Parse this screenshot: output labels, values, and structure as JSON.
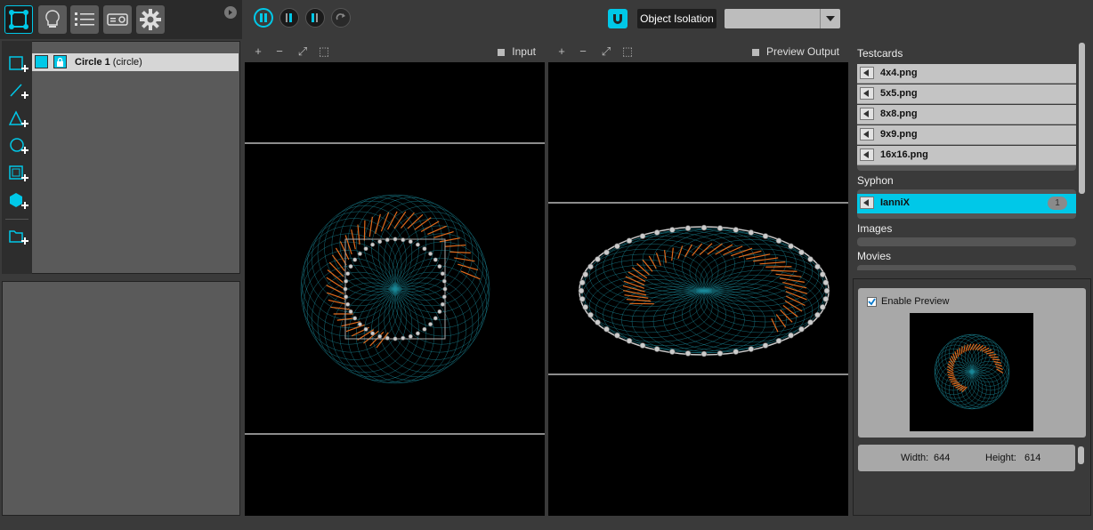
{
  "toolbar": {
    "modes": [
      {
        "name": "mapping-mode",
        "icon": "mapping-icon",
        "active": true
      },
      {
        "name": "output-mode",
        "icon": "lightbulb-icon",
        "active": false
      },
      {
        "name": "list-mode",
        "icon": "list-icon",
        "active": false
      },
      {
        "name": "projector-mode",
        "icon": "projector-icon",
        "active": false
      },
      {
        "name": "settings-mode",
        "icon": "gear-icon",
        "active": false
      }
    ],
    "object_isolation_label": "Object Isolation",
    "dropdown_value": ""
  },
  "layers": {
    "items": [
      {
        "name_bold": "Circle 1",
        "name_rest": " (circle)"
      }
    ]
  },
  "viewports": {
    "input_title": "Input",
    "output_title": "Preview Output"
  },
  "sources": {
    "testcards_title": "Testcards",
    "testcards": [
      "4x4.png",
      "5x5.png",
      "8x8.png",
      "9x9.png",
      "16x16.png"
    ],
    "syphon_title": "Syphon",
    "syphon": [
      {
        "label": "IanniX",
        "badge": "1"
      }
    ],
    "images_title": "Images",
    "movies_title": "Movies"
  },
  "preview": {
    "enable_label": "Enable Preview",
    "enabled": true,
    "width_label": "Width:",
    "width_value": "644",
    "height_label": "Height:",
    "height_value": "614"
  },
  "colors": {
    "accent": "#00c8e8",
    "orange": "#e06a1c",
    "teal": "#1a8a9a"
  }
}
